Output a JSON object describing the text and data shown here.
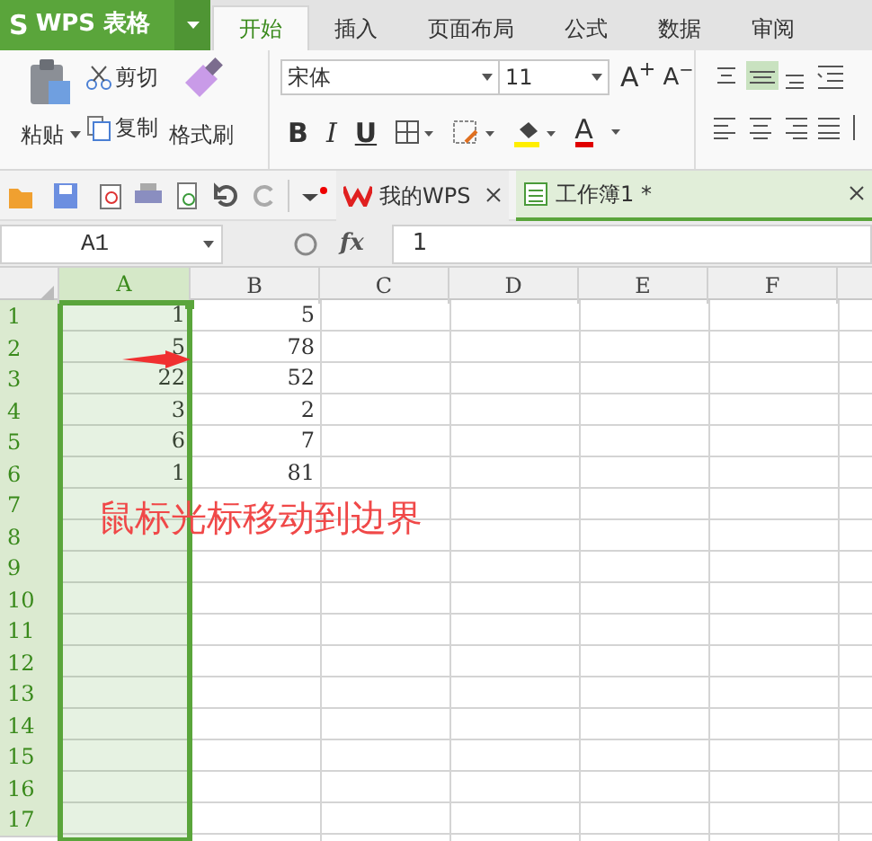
{
  "app": {
    "logo": "S",
    "title": "WPS 表格"
  },
  "ribbon_tabs": [
    {
      "label": "开始",
      "selected": true
    },
    {
      "label": "插入",
      "selected": false
    },
    {
      "label": "页面布局",
      "selected": false
    },
    {
      "label": "公式",
      "selected": false
    },
    {
      "label": "数据",
      "selected": false
    },
    {
      "label": "审阅",
      "selected": false
    }
  ],
  "clipboard": {
    "paste": "粘贴",
    "cut": "剪切",
    "copy": "复制",
    "format_painter": "格式刷"
  },
  "font": {
    "name": "宋体",
    "size": "11",
    "grow": "A$^{+}$",
    "shrink": "A$^{−}$",
    "bold": "B",
    "italic": "I",
    "underline": "U",
    "font_color": "A"
  },
  "doc_tabs": [
    {
      "label": "我的WPS",
      "selected": false
    },
    {
      "label": "工作簿1 *",
      "selected": true
    }
  ],
  "name_box": "A1",
  "fx": "fx",
  "formula": "1",
  "columns": [
    {
      "label": "A",
      "selected": true
    },
    {
      "label": "B",
      "selected": false
    },
    {
      "label": "C",
      "selected": false
    },
    {
      "label": "D",
      "selected": false
    },
    {
      "label": "E",
      "selected": false
    },
    {
      "label": "F",
      "selected": false
    }
  ],
  "rows": [
    {
      "label": "1",
      "cells": [
        "1",
        "5"
      ]
    },
    {
      "label": "2",
      "cells": [
        "5",
        "78"
      ]
    },
    {
      "label": "3",
      "cells": [
        "22",
        "52"
      ]
    },
    {
      "label": "4",
      "cells": [
        "3",
        "2"
      ]
    },
    {
      "label": "5",
      "cells": [
        "6",
        "7"
      ]
    },
    {
      "label": "6",
      "cells": [
        "1",
        "81"
      ]
    },
    {
      "label": "7"
    },
    {
      "label": "8"
    },
    {
      "label": "9"
    },
    {
      "label": "10"
    },
    {
      "label": "11"
    },
    {
      "label": "12"
    },
    {
      "label": "13"
    },
    {
      "label": "14"
    },
    {
      "label": "15"
    },
    {
      "label": "16"
    },
    {
      "label": "17"
    }
  ],
  "annotation": "鼠标光标移动到边界"
}
